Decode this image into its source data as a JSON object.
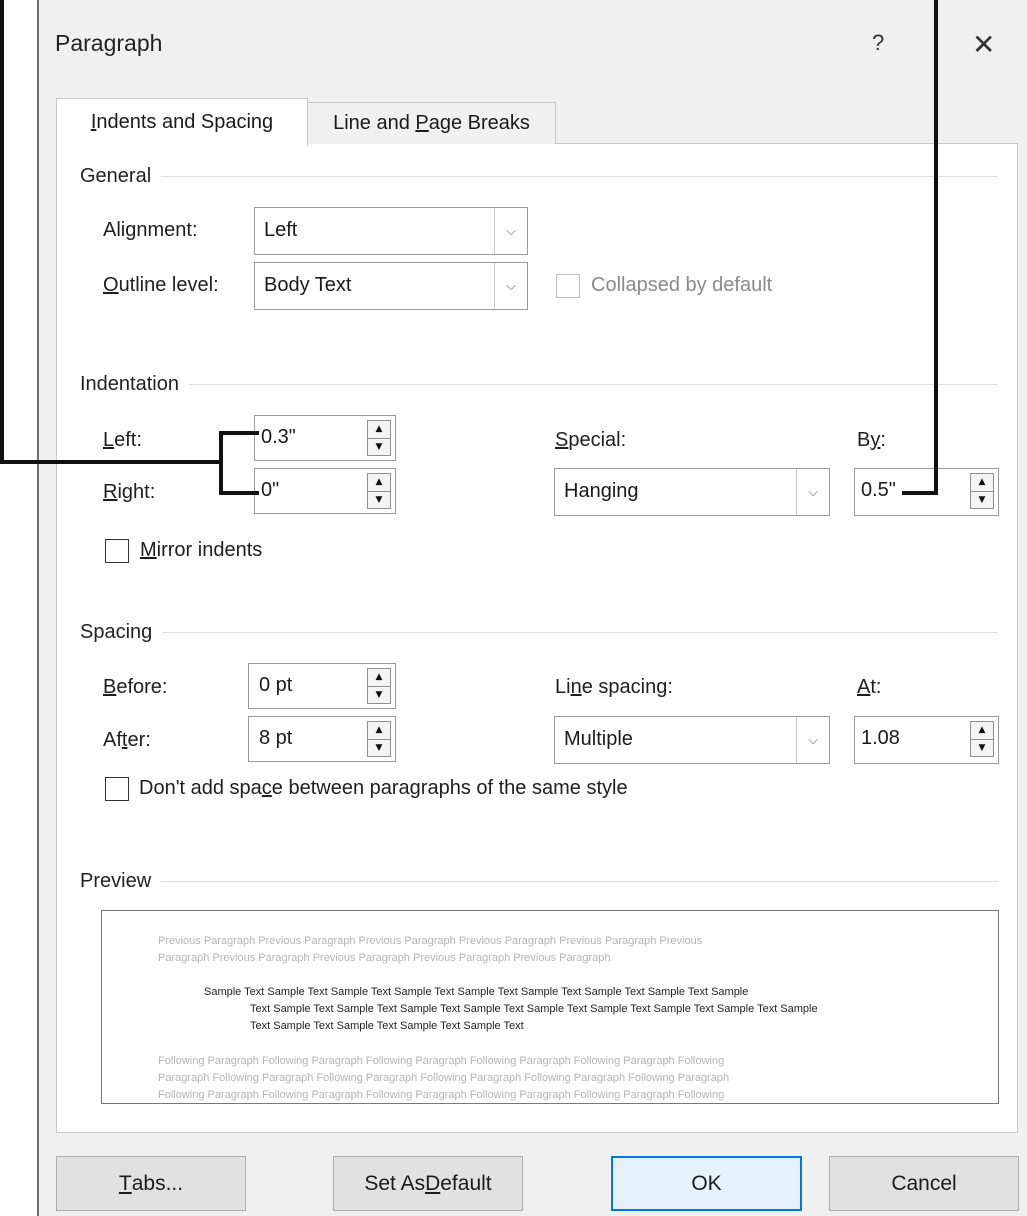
{
  "dialog": {
    "title": "Paragraph",
    "help": "?",
    "close": "✕"
  },
  "tabs": [
    {
      "label_pre": "",
      "accel": "I",
      "label_post": "ndents and Spacing"
    },
    {
      "label_pre": "Line and ",
      "accel": "P",
      "label_post": "age Breaks"
    }
  ],
  "general": {
    "title": "General",
    "alignment": {
      "label_pre": "Ali",
      "accel": "g",
      "label_post": "nment:",
      "value": "Left"
    },
    "outline": {
      "label_pre": "",
      "accel": "O",
      "label_post": "utline level:",
      "value": "Body Text"
    },
    "collapsed_label": "Collapsed by default"
  },
  "indentation": {
    "title": "Indentation",
    "left": {
      "label_pre": "",
      "accel": "L",
      "label_post": "eft:",
      "value": "0.3\""
    },
    "right": {
      "label_pre": "",
      "accel": "R",
      "label_post": "ight:",
      "value": "0\""
    },
    "special": {
      "label_pre": "",
      "accel": "S",
      "label_post": "pecial:",
      "value": "Hanging"
    },
    "by": {
      "label_pre": "B",
      "accel": "y",
      "label_post": ":",
      "value": "0.5\""
    },
    "mirror": {
      "label_pre": "",
      "accel": "M",
      "label_post": "irror indents"
    }
  },
  "spacing": {
    "title": "Spacing",
    "before": {
      "label_pre": "",
      "accel": "B",
      "label_post": "efore:",
      "value": "0 pt"
    },
    "after": {
      "label_pre": "Af",
      "accel": "t",
      "label_post": "er:",
      "value": "8 pt"
    },
    "line_spacing": {
      "label_pre": "Li",
      "accel": "n",
      "label_post": "e spacing:",
      "value": "Multiple"
    },
    "at": {
      "label_pre": "",
      "accel": "A",
      "label_post": "t:",
      "value": "1.08"
    },
    "dont_add": {
      "label_pre": "Don't add spa",
      "accel": "c",
      "label_post": "e between paragraphs of the same style"
    }
  },
  "preview": {
    "title": "Preview",
    "previous": [
      "Previous Paragraph Previous Paragraph Previous Paragraph Previous Paragraph Previous Paragraph Previous",
      "Paragraph Previous Paragraph Previous Paragraph Previous Paragraph Previous Paragraph"
    ],
    "sample": [
      "Sample Text Sample Text Sample Text Sample Text Sample Text Sample Text Sample Text Sample Text Sample",
      "Text Sample Text Sample Text Sample Text Sample Text Sample Text Sample Text Sample Text Sample Text Sample",
      "Text Sample Text Sample Text Sample Text Sample Text"
    ],
    "following": [
      "Following Paragraph Following Paragraph Following Paragraph Following Paragraph Following Paragraph Following",
      "Paragraph Following Paragraph Following Paragraph Following Paragraph Following Paragraph Following Paragraph",
      "Following Paragraph Following Paragraph Following Paragraph Following Paragraph Following Paragraph Following"
    ]
  },
  "buttons": {
    "tabs": {
      "label_pre": "",
      "accel": "T",
      "label_post": "abs..."
    },
    "set_default": {
      "label_pre": "Set As ",
      "accel": "D",
      "label_post": "efault"
    },
    "ok": "OK",
    "cancel": "Cancel"
  },
  "colors": {
    "accent": "#0078d7",
    "dialog_bg": "#f0f0f0",
    "panel_bg": "#ffffff"
  },
  "icons": [
    "help-icon",
    "close-icon",
    "chevron-down-icon",
    "spin-up-icon",
    "spin-down-icon",
    "checkbox-icon"
  ]
}
